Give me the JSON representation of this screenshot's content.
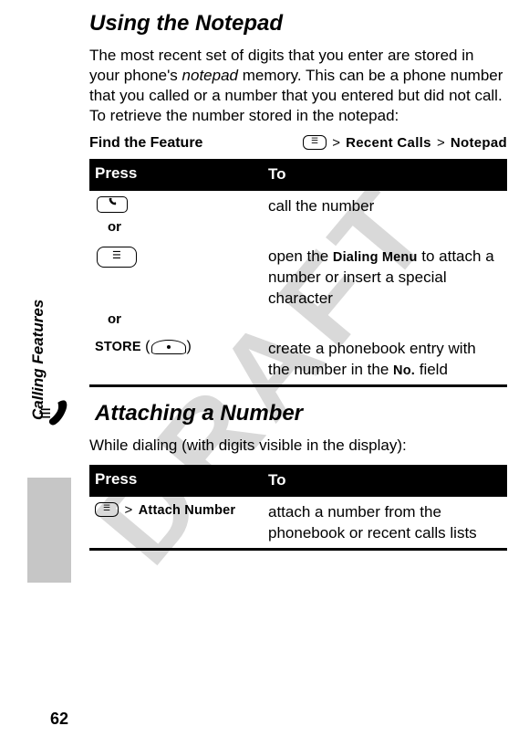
{
  "watermark": "DRAFT",
  "side_label": "Calling Features",
  "page_number": "62",
  "section1": {
    "title": "Using the Notepad",
    "body_before": "The most recent set of digits that you enter are stored in your phone's ",
    "body_italic": "notepad",
    "body_after": " memory. This can be a phone number that you called or a number that you entered but did not call. To retrieve the number stored in the notepad:",
    "feature_label": "Find the Feature",
    "breadcrumb": {
      "key_glyph": "☰",
      "part1": "Recent Calls",
      "part2": "Notepad",
      "gt": ">"
    },
    "table": {
      "h1": "Press",
      "h2": "To",
      "r1": {
        "key_glyph": "📞",
        "to": "call the number"
      },
      "or": "or",
      "r2": {
        "key_glyph": "☰",
        "to_prefix": "open the ",
        "to_bold": "Dialing Menu",
        "to_suffix": " to attach a number or insert a special character"
      },
      "r3": {
        "label": "STORE",
        "paren_open": " (",
        "paren_close": ")",
        "to_prefix": "create a phonebook entry with the number in the ",
        "to_bold": "No.",
        "to_suffix": " field"
      }
    }
  },
  "section2": {
    "title": "Attaching a Number",
    "body": "While dialing (with digits visible in the display):",
    "table": {
      "h1": "Press",
      "h2": "To",
      "r1": {
        "key_glyph": "☰",
        "gt": ">",
        "label": "Attach Number",
        "to": "attach a number from the phonebook or recent calls lists"
      }
    }
  }
}
